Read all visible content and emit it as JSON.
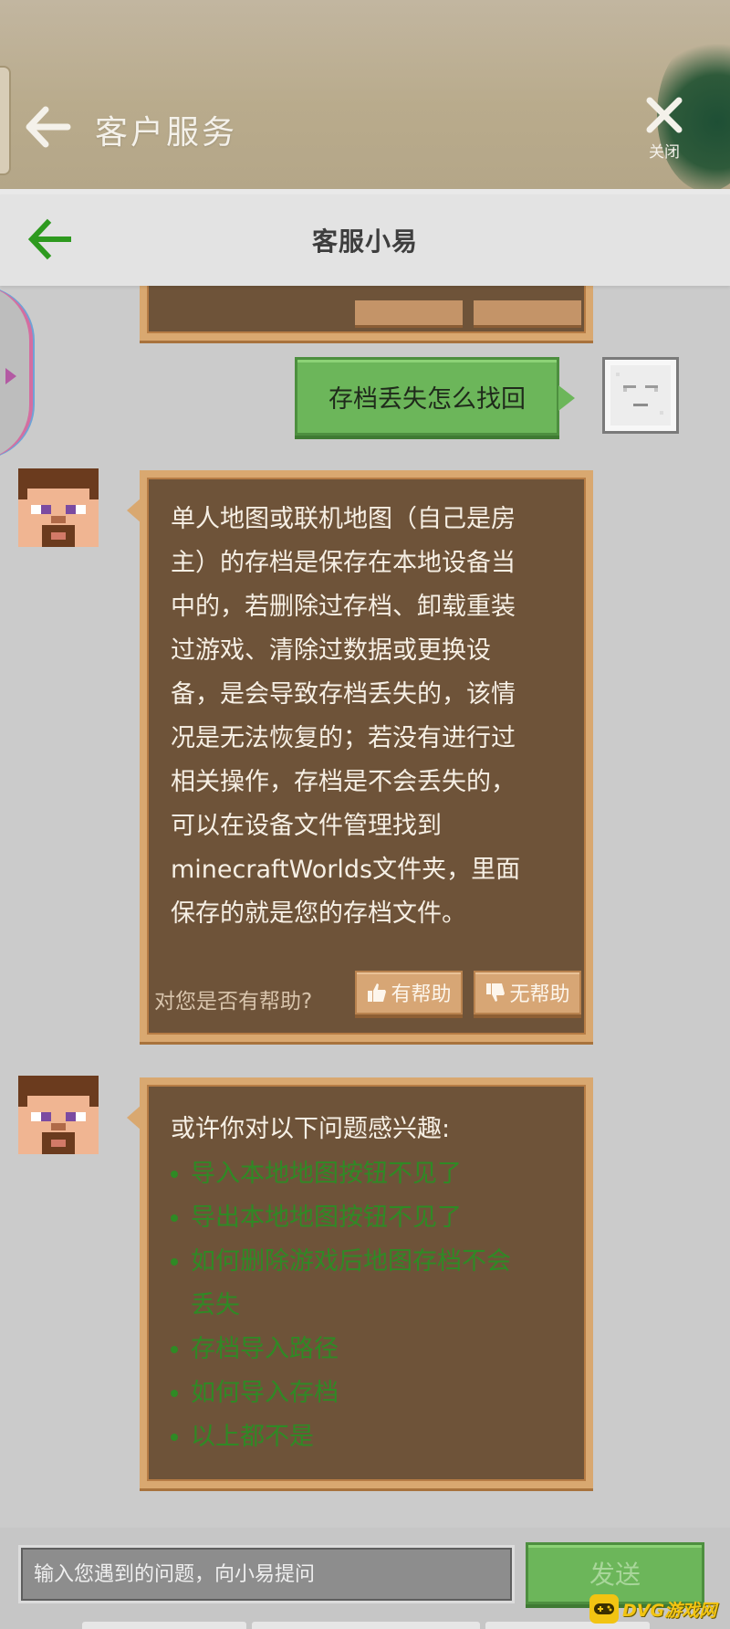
{
  "header": {
    "title": "客户服务",
    "close_label": "关闭"
  },
  "sub_header": {
    "title": "客服小易"
  },
  "conversation": {
    "user_message": "存档丢失怎么找回",
    "answer_lines": [
      "单人地图或联机地图（自己是房",
      "主）的存档是保存在本地设备当",
      "中的，若删除过存档、卸载重装",
      "过游戏、清除过数据或更换设",
      "备，是会导致存档丢失的，该情",
      "况是无法恢复的；若没有进行过",
      "相关操作，存档是不会丢失的，",
      "可以在设备文件管理找到",
      "minecraftWorlds文件夹，里面",
      "保存的就是您的存档文件。"
    ],
    "helpful_question": "对您是否有帮助?",
    "helpful_yes": "有帮助",
    "helpful_no": "无帮助",
    "suggest_intro": "或许你对以下问题感兴趣:",
    "suggestions": [
      "导入本地地图按钮不见了",
      "导出本地地图按钮不见了",
      "如何删除游戏后地图存档不会",
      "丢失",
      "存档导入路径",
      "如何导入存档",
      "以上都不是"
    ]
  },
  "input_bar": {
    "placeholder": "输入您遇到的问题，向小易提问",
    "send_label": "发送"
  },
  "watermark": {
    "text": "DVG游戏网"
  },
  "colors": {
    "bubble_brown": "#6e5339",
    "bubble_border": "#d9a870",
    "green_button": "#6cb65a",
    "link_green": "#2f8a25",
    "back_arrow_green": "#2e9a1f"
  }
}
